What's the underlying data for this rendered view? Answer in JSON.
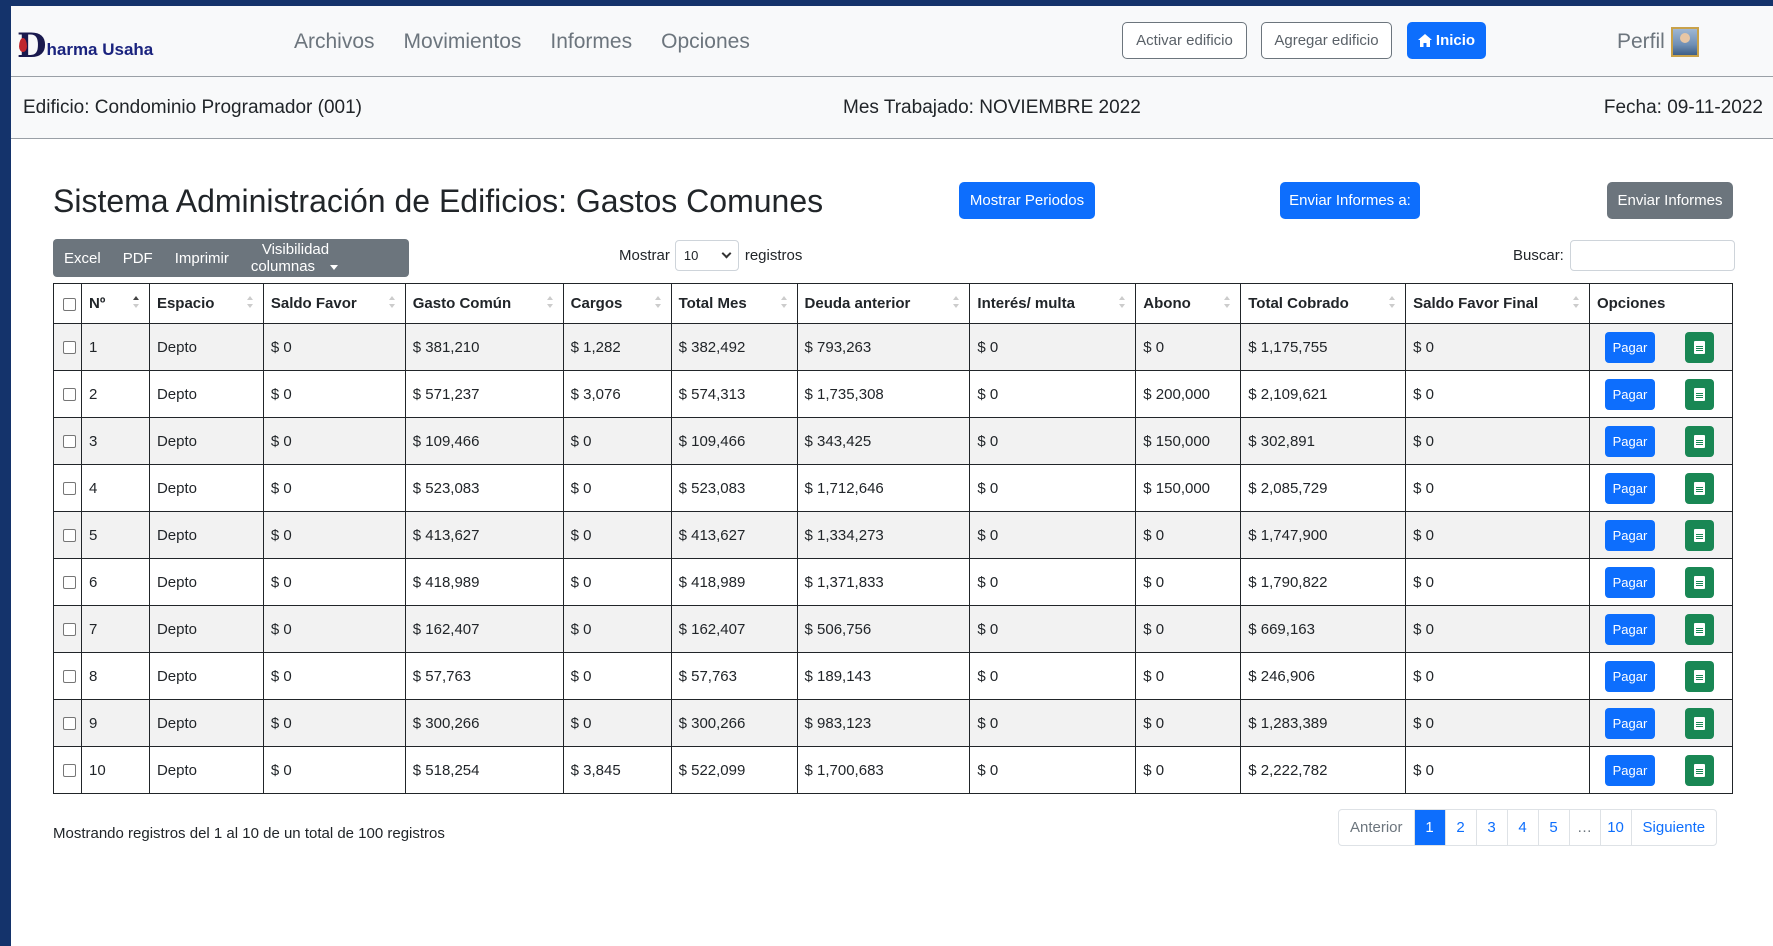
{
  "navbar": {
    "brand": "harma Usaha",
    "brand_initial": "D",
    "menu": [
      "Archivos",
      "Movimientos",
      "Informes",
      "Opciones"
    ],
    "activar_label": "Activar edificio",
    "agregar_label": "Agregar edificio",
    "inicio_label": "Inicio",
    "perfil_label": "Perfil"
  },
  "infobar": {
    "edificio": "Edificio: Condominio Programador (001)",
    "mes": "Mes Trabajado: NOVIEMBRE 2022",
    "fecha": "Fecha: 09-11-2022"
  },
  "main": {
    "title": "Sistema Administración de Edificios: Gastos Comunes",
    "mostrar_periodos": "Mostrar Periodos",
    "enviar_informes_a": "Enviar Informes a:",
    "enviar_informes": "Enviar Informes"
  },
  "toolbar": {
    "excel": "Excel",
    "pdf": "PDF",
    "imprimir": "Imprimir",
    "visibilidad": "Visibilidad columnas",
    "mostrar": "Mostrar",
    "length_value": "10",
    "registros": "registros",
    "buscar": "Buscar:"
  },
  "table": {
    "columns": [
      "Nº",
      "Espacio",
      "Saldo Favor",
      "Gasto Común",
      "Cargos",
      "Total Mes",
      "Deuda anterior",
      "Interés/ multa",
      "Abono",
      "Total Cobrado",
      "Saldo Favor Final",
      "Opciones"
    ],
    "pagar_label": "Pagar",
    "rows": [
      [
        "1",
        "Depto",
        "$ 0",
        "$ 381,210",
        "$ 1,282",
        "$ 382,492",
        "$ 793,263",
        "$ 0",
        "$ 0",
        "$ 1,175,755",
        "$ 0"
      ],
      [
        "2",
        "Depto",
        "$ 0",
        "$ 571,237",
        "$ 3,076",
        "$ 574,313",
        "$ 1,735,308",
        "$ 0",
        "$ 200,000",
        "$ 2,109,621",
        "$ 0"
      ],
      [
        "3",
        "Depto",
        "$ 0",
        "$ 109,466",
        "$ 0",
        "$ 109,466",
        "$ 343,425",
        "$ 0",
        "$ 150,000",
        "$ 302,891",
        "$ 0"
      ],
      [
        "4",
        "Depto",
        "$ 0",
        "$ 523,083",
        "$ 0",
        "$ 523,083",
        "$ 1,712,646",
        "$ 0",
        "$ 150,000",
        "$ 2,085,729",
        "$ 0"
      ],
      [
        "5",
        "Depto",
        "$ 0",
        "$ 413,627",
        "$ 0",
        "$ 413,627",
        "$ 1,334,273",
        "$ 0",
        "$ 0",
        "$ 1,747,900",
        "$ 0"
      ],
      [
        "6",
        "Depto",
        "$ 0",
        "$ 418,989",
        "$ 0",
        "$ 418,989",
        "$ 1,371,833",
        "$ 0",
        "$ 0",
        "$ 1,790,822",
        "$ 0"
      ],
      [
        "7",
        "Depto",
        "$ 0",
        "$ 162,407",
        "$ 0",
        "$ 162,407",
        "$ 506,756",
        "$ 0",
        "$ 0",
        "$ 669,163",
        "$ 0"
      ],
      [
        "8",
        "Depto",
        "$ 0",
        "$ 57,763",
        "$ 0",
        "$ 57,763",
        "$ 189,143",
        "$ 0",
        "$ 0",
        "$ 246,906",
        "$ 0"
      ],
      [
        "9",
        "Depto",
        "$ 0",
        "$ 300,266",
        "$ 0",
        "$ 300,266",
        "$ 983,123",
        "$ 0",
        "$ 0",
        "$ 1,283,389",
        "$ 0"
      ],
      [
        "10",
        "Depto",
        "$ 0",
        "$ 518,254",
        "$ 3,845",
        "$ 522,099",
        "$ 1,700,683",
        "$ 0",
        "$ 0",
        "$ 2,222,782",
        "$ 0"
      ]
    ]
  },
  "footer": {
    "info": "Mostrando registros del 1 al 10 de un total de 100 registros",
    "anterior": "Anterior",
    "pages": [
      "1",
      "2",
      "3",
      "4",
      "5",
      "…",
      "10"
    ],
    "siguiente": "Siguiente"
  },
  "colors": {
    "primary": "#0d6efd",
    "secondary": "#6c757d",
    "success": "#198754",
    "background": "#14336b"
  },
  "icons": [
    "home-icon",
    "document-icon",
    "sort-icon",
    "caret-down-icon",
    "chevron-down-icon"
  ]
}
